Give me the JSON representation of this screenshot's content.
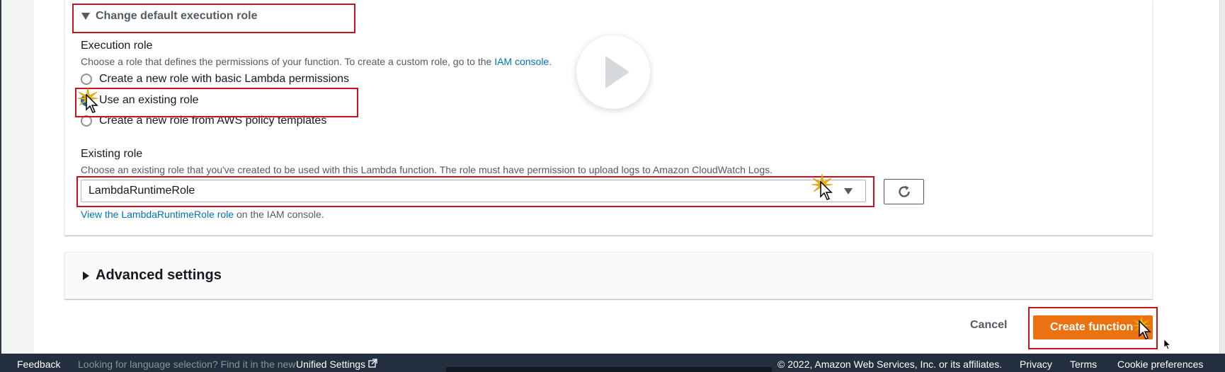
{
  "execution_role_section": {
    "expander_label": "Change default execution role",
    "field_label": "Execution role",
    "description_prefix": "Choose a role that defines the permissions of your function. To create a custom role, go to the",
    "description_link": "IAM console",
    "description_suffix": ".",
    "options": [
      {
        "label": "Create a new role with basic Lambda permissions",
        "selected": false
      },
      {
        "label": "Use an existing role",
        "selected": true
      },
      {
        "label": "Create a new role from AWS policy templates",
        "selected": false
      }
    ]
  },
  "existing_role": {
    "label": "Existing role",
    "description": "Choose an existing role that you've created to be used with this Lambda function. The role must have permission to upload logs to Amazon CloudWatch Logs.",
    "selected_value": "LambdaRuntimeRole",
    "view_link": "View the LambdaRuntimeRole role",
    "view_suffix": "on the IAM console."
  },
  "advanced": {
    "label": "Advanced settings"
  },
  "actions": {
    "cancel": "Cancel",
    "create": "Create function"
  },
  "footer": {
    "feedback": "Feedback",
    "language_text": "Looking for language selection? Find it in the new",
    "unified_settings": "Unified Settings",
    "copyright": "© 2022, Amazon Web Services, Inc. or its affiliates.",
    "privacy": "Privacy",
    "terms": "Terms",
    "cookie": "Cookie preferences"
  },
  "colors": {
    "primary_button": "#ec7211",
    "link": "#0073bb",
    "highlight_box": "#c7131f",
    "footer_bg": "#232f3e"
  },
  "icons": [
    "caret-down-icon",
    "caret-right-icon",
    "refresh-icon",
    "external-link-icon",
    "play-icon",
    "cursor-icon",
    "click-burst-icon"
  ]
}
